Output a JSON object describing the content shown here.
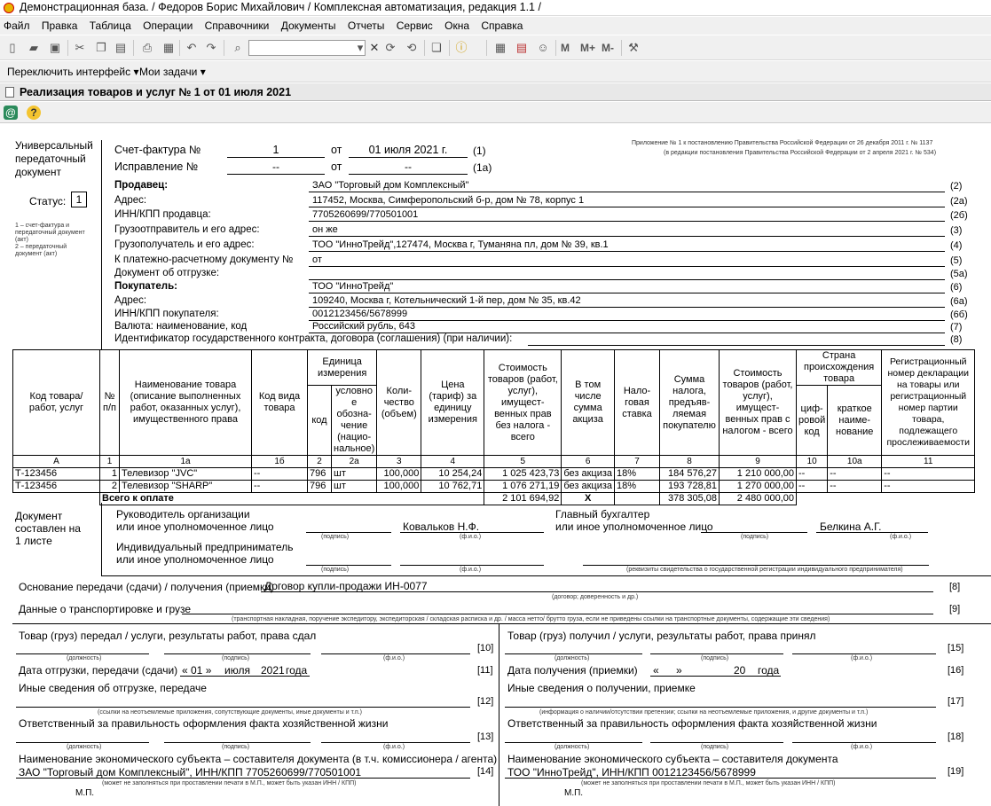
{
  "window": {
    "title": "Демонстрационная база. / Федоров Борис Михайлович /  Комплексная автоматизация, редакция 1.1 /"
  },
  "menu": [
    "Файл",
    "Правка",
    "Таблица",
    "Операции",
    "Справочники",
    "Документы",
    "Отчеты",
    "Сервис",
    "Окна",
    "Справка"
  ],
  "toolbar": {
    "m": "M",
    "mplus": "M+",
    "mminus": "M-"
  },
  "bar2": {
    "switch": "Переключить интерфейс",
    "tasks": "Мои задачи"
  },
  "doc_title": "Реализация товаров и услуг № 1 от 01 июля 2021",
  "upd": {
    "title_l1": "Универсальный",
    "title_l2": "передаточный",
    "title_l3": "документ",
    "status_label": "Статус:",
    "status": "1",
    "status_note1": "1 – счет-фактура и",
    "status_note2": "передаточный документ",
    "status_note3": "(акт)",
    "status_note4": "2 – передаточный",
    "status_note5": "документ (акт)",
    "invoice_label": "Счет-фактура №",
    "invoice_no": "1",
    "ot": "от",
    "invoice_date": "01 июля 2021 г.",
    "r1": "(1)",
    "correction_label": "Исправление №",
    "correction_no": "--",
    "correction_date": "--",
    "r1a": "(1а)",
    "appendix1": "Приложение № 1 к постановлению Правительства Российской Федерации от 26 декабря 2011 г. № 1137",
    "appendix2": "(в редакции постановления Правительства Российской Федерации от 2 апреля 2021 г. № 534)",
    "fields": [
      {
        "label": "Продавец:",
        "value": "ЗАО \"Торговый дом Комплексный\"",
        "ref": "(2)",
        "bold": true
      },
      {
        "label": "Адрес:",
        "value": "117452, Москва, Симферопольский б-р, дом № 78, корпус 1",
        "ref": "(2а)"
      },
      {
        "label": "ИНН/КПП продавца:",
        "value": "7705260699/770501001",
        "ref": "(2б)"
      },
      {
        "label": "Грузоотправитель и его адрес:",
        "value": "он же",
        "ref": "(3)"
      },
      {
        "label": "Грузополучатель и его адрес:",
        "value": "ТОО \"ИнноТрейд\",127474, Москва г, Туманяна пл, дом № 39, кв.1",
        "ref": "(4)"
      },
      {
        "label": "К платежно-расчетному документу №",
        "value": "  от",
        "ref": "(5)"
      },
      {
        "label": "Документ об отгрузке:",
        "value": "",
        "ref": "(5а)"
      },
      {
        "label": "Покупатель:",
        "value": "ТОО \"ИнноТрейд\"",
        "ref": "(6)",
        "bold": true
      },
      {
        "label": "Адрес:",
        "value": "109240, Москва г, Котельнический 1-й пер, дом № 35, кв.42",
        "ref": "(6а)"
      },
      {
        "label": "ИНН/КПП покупателя:",
        "value": "0012123456/5678999",
        "ref": "(6б)"
      },
      {
        "label": "Валюта: наименование, код",
        "value": "Российский рубль, 643",
        "ref": "(7)"
      }
    ],
    "contract_label": "Идентификатор государственного контракта, договора (соглашения) (при наличии):",
    "contract_ref": "(8)"
  },
  "table": {
    "headers": {
      "code": "Код товара/ работ, услуг",
      "np": "№ п/п",
      "name": "Наименование товара (описание выполненных работ, оказанных услуг), имущественного права",
      "kind": "Код вида товара",
      "unit": "Единица измерения",
      "unit_code": "код",
      "unit_name": "условно е обозна- чение (нацио- нальное)",
      "qty": "Коли- чество (объем)",
      "price": "Цена (тариф) за единицу измерения",
      "cost_wo": "Стоимость товаров (работ, услуг), имущест- венных прав без налога - всего",
      "excise": "В том числе сумма акциза",
      "rate": "Нало- говая ставка",
      "tax": "Сумма налога, предъяв- ляемая покупателю",
      "cost_w": "Стоимость товаров (работ, услуг), имущест- венных прав с налогом - всего",
      "country": "Страна происхождения товара",
      "country_code": "циф- ровой код",
      "country_name": "краткое наиме- нование",
      "decl": "Регистрационный номер декларации на товары или регистрационный номер партии товара, подлежащего прослеживаемости"
    },
    "numbers": [
      "А",
      "1",
      "1а",
      "1б",
      "2",
      "2а",
      "3",
      "4",
      "5",
      "6",
      "7",
      "8",
      "9",
      "10",
      "10а",
      "11"
    ],
    "rows": [
      {
        "code": "Т-123456",
        "np": "1",
        "name": "Телевизор \"JVC\"",
        "kind": "--",
        "ucode": "796",
        "uname": "шт",
        "qty": "100,000",
        "price": "10 254,24",
        "cost_wo": "1 025 423,73",
        "excise": "без акциза",
        "rate": "18%",
        "tax": "184 576,27",
        "cost_w": "1 210 000,00",
        "ccode": "--",
        "cname": "--",
        "decl": "--"
      },
      {
        "code": "Т-123456",
        "np": "2",
        "name": "Телевизор \"SHARP\"",
        "kind": "--",
        "ucode": "796",
        "uname": "шт",
        "qty": "100,000",
        "price": "10 762,71",
        "cost_wo": "1 076 271,19",
        "excise": "без акциза",
        "rate": "18%",
        "tax": "193 728,81",
        "cost_w": "1 270 000,00",
        "ccode": "--",
        "cname": "--",
        "decl": "--"
      }
    ],
    "total": {
      "label": "Всего к оплате",
      "cost_wo": "2 101 694,92",
      "excise": "Х",
      "tax": "378 305,08",
      "cost_w": "2 480 000,00"
    }
  },
  "signs": {
    "doc_l1": "Документ",
    "doc_l2": "составлен на",
    "doc_l3": "1 листе",
    "head1": "Руководитель организации",
    "head2": "или иное уполномоченное лицо",
    "head_name": "Ковальков Н.Ф.",
    "acc1": "Главный бухгалтер",
    "acc2": "или иное уполномоченное лицо",
    "acc_name": "Белкина А.Г.",
    "ip1": "Индивидуальный предприниматель",
    "ip2": "или иное уполномоченное лицо",
    "podpis": "(подпись)",
    "fio": "(ф.и.о.)",
    "requisites": "(реквизиты свидетельства о государственной  регистрации индивидуального предпринимателя)"
  },
  "bottom": {
    "basis_label": "Основание передачи (сдачи) / получения (приемки)",
    "basis_value": "Договор купли-продажи ИН-0077",
    "basis_note": "(договор; доверенность и др.)",
    "r8": "[8]",
    "transport_label": "Данные о транспортировке и грузе",
    "transport_note": "(транспортная накладная, поручение экспедитору, экспедиторская / складская расписка и др. / масса нетто/ брутто груза, если не приведены ссылки на транспортные документы, содержащие эти сведения)",
    "r9": "[9]",
    "left": {
      "passed": "Товар (груз) передал / услуги, результаты работ, права сдал",
      "r10": "[10]",
      "dolzh": "(должность)",
      "podpis": "(подпись)",
      "fio": "(ф.и.о.)",
      "date_label": "Дата отгрузки, передачи (сдачи)",
      "date_d": "« 01 »",
      "date_m": "июля",
      "date_y": "2021",
      "date_g": "года",
      "r11": "[11]",
      "other": "Иные сведения об отгрузке, передаче",
      "other_note": "(ссылки на неотъемлемые приложения, сопутствующие документы, иные документы и т.п.)",
      "r12": "[12]",
      "resp": "Ответственный за правильность оформления факта хозяйственной жизни",
      "r13": "[13]",
      "entity": "Наименование экономического субъекта – составителя документа (в т.ч. комиссионера / агента)",
      "entity_value": "ЗАО \"Торговый дом Комплексный\", ИНН/КПП 7705260699/770501001",
      "entity_note": "(может не заполняться при проставлении печати в М.П., может быть указан ИНН / КПП)",
      "r14": "[14]",
      "mp": "М.П."
    },
    "right": {
      "received": "Товар (груз) получил / услуги, результаты работ, права принял",
      "r15": "[15]",
      "dolzh": "(должность)",
      "podpis": "(подпись)",
      "fio": "(ф.и.о.)",
      "date_label": "Дата получения (приемки)",
      "date_d": "«",
      "date_q": "»",
      "date_y": "20",
      "date_g": "года",
      "r16": "[16]",
      "other": "Иные сведения о получении, приемке",
      "other_note": "(информация о наличии/отсутствии претензии; ссылки на неотъемлемые приложения, и другие  документы и т.п.)",
      "r17": "[17]",
      "resp": "Ответственный за правильность оформления факта хозяйственной жизни",
      "r18": "[18]",
      "entity": "Наименование экономического субъекта – составителя документа",
      "entity_value": "ТОО \"ИнноТрейд\", ИНН/КПП 0012123456/5678999",
      "entity_note": "(может не заполняться при проставлении печати в М.П., может быть указан ИНН / КПП)",
      "r19": "[19]",
      "mp": "М.П."
    }
  }
}
